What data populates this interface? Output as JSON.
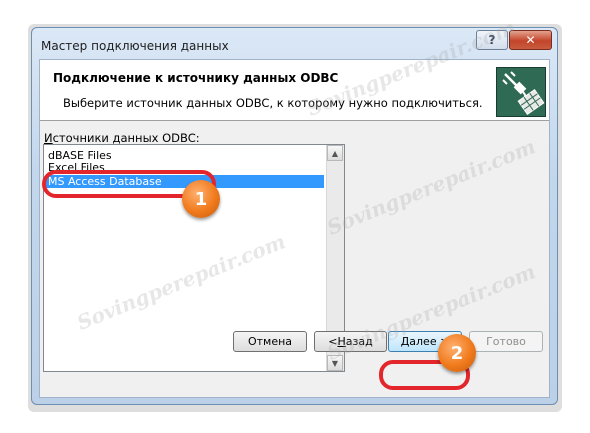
{
  "window": {
    "title": "Мастер подключения данных",
    "help_label": "?",
    "close_label": "✕"
  },
  "header": {
    "title": "Подключение к источнику данных ODBC",
    "subtitle": "Выберите источник данных ODBC, к которому нужно подключиться."
  },
  "list": {
    "label_underlined": "И",
    "label_rest": "сточники данных ODBC:",
    "items": [
      {
        "label": "dBASE Files",
        "selected": false
      },
      {
        "label": "Excel Files",
        "selected": false
      },
      {
        "label": "MS Access Database",
        "selected": true
      }
    ]
  },
  "buttons": {
    "cancel": "Отмена",
    "back_prefix": "< ",
    "back_underlined": "Н",
    "back_rest": "азад",
    "next_underlined": "Д",
    "next_rest": "алее >",
    "finish": "Готово"
  },
  "annotations": {
    "badge1": "1",
    "badge2": "2",
    "accent_color": "#e3262b",
    "badge_color": "#f07a1c"
  },
  "watermark_text": "Sovingperepair.com"
}
